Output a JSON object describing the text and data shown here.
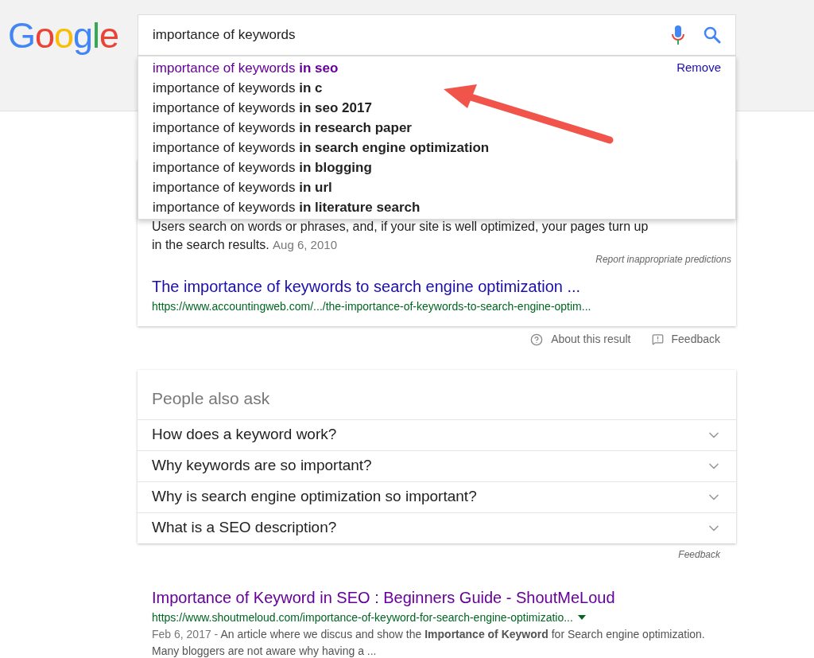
{
  "logo": "Google",
  "search": {
    "value": "importance of keywords"
  },
  "suggestions": [
    {
      "text": "importance of keywords **in seo**",
      "visited": true,
      "action": "Remove"
    },
    {
      "text": "importance of keywords **in c**",
      "visited": false
    },
    {
      "text": "importance of keywords **in seo 2017**",
      "visited": false
    },
    {
      "text": "importance of keywords **in research paper**",
      "visited": false
    },
    {
      "text": "importance of keywords **in search engine optimization**",
      "visited": false
    },
    {
      "text": "importance of keywords **in blogging**",
      "visited": false
    },
    {
      "text": "importance of keywords **in url**",
      "visited": false
    },
    {
      "text": "importance of keywords **in literature search**",
      "visited": false
    }
  ],
  "report_link": "Report inappropriate predictions",
  "featured": {
    "snippet": "Users search on words or phrases, and, if your site is well optimized, your pages turn up in the search results.",
    "date": "Aug 6, 2010",
    "title": "The importance of keywords to search engine optimization ...",
    "url": "https://www.accountingweb.com/.../the-importance-of-keywords-to-search-engine-optim..."
  },
  "featured_footer": [
    "About this result",
    "Feedback"
  ],
  "people_also_ask": {
    "title": "People also ask",
    "questions": [
      {
        "text": "How does a keyword work?",
        "expanded": false
      },
      {
        "text": "Why keywords are so important?",
        "expanded": false
      },
      {
        "text": "Why is search engine optimization so important?",
        "expanded": false
      },
      {
        "text": "What is a SEO description?",
        "expanded": false
      }
    ],
    "feedback": "Feedback"
  },
  "results": [
    {
      "title": "Importance of Keyword in SEO : Beginners Guide - ShoutMeLoud",
      "url": "https://www.shoutmeloud.com/importance-of-keyword-for-search-engine-optimizatio...",
      "date": "Feb 6, 2017 -",
      "snippet": "An article where we discus and show the **Importance of Keyword** for Search engine optimization. Many bloggers are not aware why having a ...",
      "visited": true
    }
  ]
}
